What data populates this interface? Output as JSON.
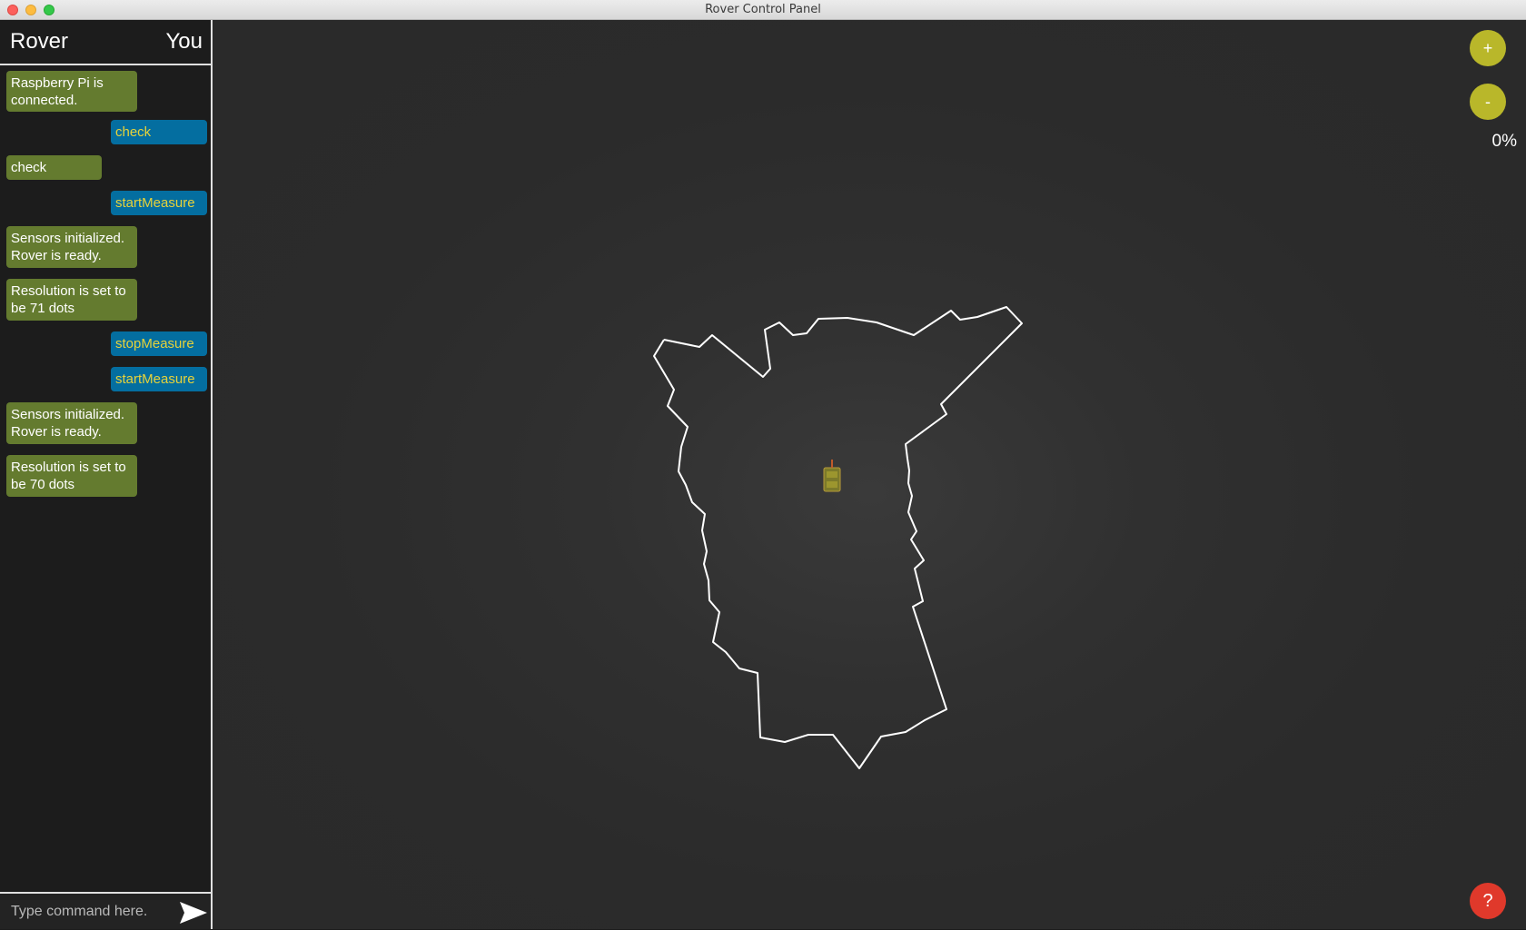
{
  "window": {
    "title": "Rover Control Panel"
  },
  "sidebar": {
    "rover_label": "Rover",
    "you_label": "You",
    "messages": [
      {
        "from": "rover",
        "text": "Raspberry Pi is connected."
      },
      {
        "from": "you",
        "text": "check"
      },
      {
        "from": "rover",
        "text": "check"
      },
      {
        "from": "you",
        "text": "startMeasure"
      },
      {
        "from": "rover",
        "text": "Sensors initialized. Rover is ready."
      },
      {
        "from": "rover",
        "text": "Resolution is set to be 71 dots"
      },
      {
        "from": "you",
        "text": "stopMeasure"
      },
      {
        "from": "you",
        "text": "startMeasure"
      },
      {
        "from": "rover",
        "text": "Sensors initialized. Rover is ready."
      },
      {
        "from": "rover",
        "text": "Resolution is set to be 70 dots"
      }
    ],
    "command_placeholder": "Type command here."
  },
  "controls": {
    "zoom_in_label": "+",
    "zoom_out_label": "-",
    "zoom_level": "0%",
    "help_label": "?"
  },
  "colors": {
    "rover_bubble": "#647b2f",
    "user_bubble": "#046ea0",
    "user_text": "#e6d23a",
    "zoom_button": "#b9b72a",
    "help_button": "#e0392b",
    "outline": "#ffffff"
  },
  "icons": {
    "send": "send-icon",
    "rover": "rover-icon"
  }
}
